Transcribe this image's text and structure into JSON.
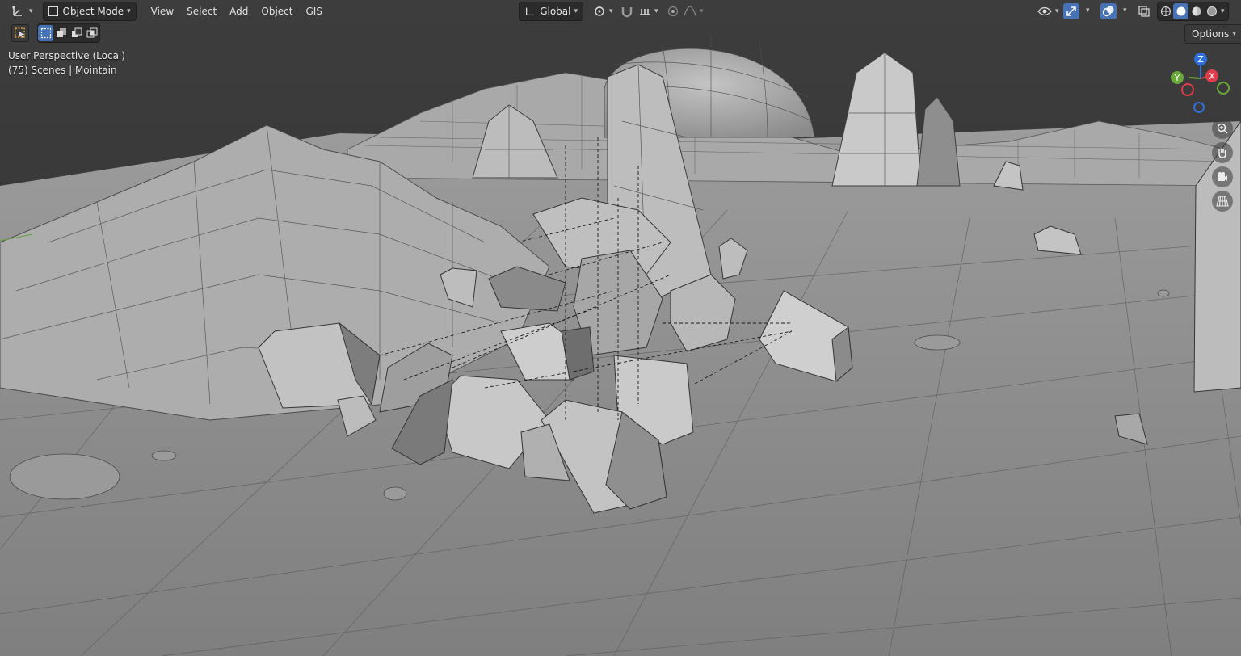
{
  "header": {
    "editor_type_icon": "transform-gizmo-icon",
    "mode_label": "Object Mode",
    "menus": [
      "View",
      "Select",
      "Add",
      "Object",
      "GIS"
    ],
    "orientation_label": "Global",
    "pivot_icon": "pivot-point-icon",
    "snap_icon": "magnet-icon",
    "snap_increment_icon": "snap-increment-icon",
    "proportional_icon": "proportional-edit-icon",
    "falloff_icon": "falloff-curve-icon",
    "visibility_icon": "eye-icon",
    "gizmo_icon": "gizmo-arrows-icon",
    "overlay_icon": "overlay-icon",
    "xray_icon": "xray-icon",
    "shading_modes": [
      "wireframe-shading-icon",
      "solid-shading-icon",
      "material-shading-icon",
      "rendered-shading-icon"
    ],
    "active_shading": 1
  },
  "toolbar2": {
    "tool_icon": "select-box-tool-icon",
    "select_modes": [
      "select-new-icon",
      "select-extend-icon",
      "select-subtract-icon",
      "select-intersect-icon"
    ],
    "options_label": "Options"
  },
  "viewport": {
    "perspective_label": "User Perspective (Local)",
    "scene_info": "(75) Scenes | Mointain"
  },
  "gizmo": {
    "axes": [
      {
        "label": "Z",
        "color": "#2f6fe0"
      },
      {
        "label": "X",
        "color": "#e03c4b"
      },
      {
        "label": "Y",
        "color": "#6aa83a"
      }
    ]
  },
  "navigation": [
    "zoom-icon",
    "hand-pan-icon",
    "camera-icon",
    "grid-perspective-icon"
  ],
  "colors": {
    "accent": "#4772b3",
    "background": "#2b2b2b",
    "ground": "#8d8d8d"
  }
}
